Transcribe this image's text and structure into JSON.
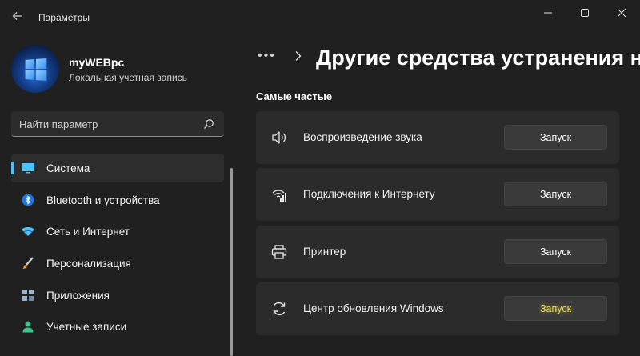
{
  "window": {
    "title": "Параметры",
    "controls": [
      "minimize-icon",
      "maximize-icon",
      "close-icon"
    ]
  },
  "profile": {
    "name": "myWEBpc",
    "account_type": "Локальная учетная запись"
  },
  "search": {
    "placeholder": "Найти параметр"
  },
  "sidebar": {
    "items": [
      {
        "label": "Система",
        "icon": "monitor-icon",
        "active": true
      },
      {
        "label": "Bluetooth и устройства",
        "icon": "bluetooth-icon",
        "active": false
      },
      {
        "label": "Сеть и Интернет",
        "icon": "wifi-icon",
        "active": false
      },
      {
        "label": "Персонализация",
        "icon": "brush-icon",
        "active": false
      },
      {
        "label": "Приложения",
        "icon": "apps-icon",
        "active": false
      },
      {
        "label": "Учетные записи",
        "icon": "person-icon",
        "active": false
      }
    ]
  },
  "header": {
    "breadcrumb_more": "•••",
    "title": "Другие средства устранения неполадок"
  },
  "section": {
    "title": "Самые частые"
  },
  "troubleshooters": [
    {
      "label": "Воспроизведение звука",
      "icon": "speaker-icon",
      "button": "Запуск"
    },
    {
      "label": "Подключения к Интернету",
      "icon": "network-icon",
      "button": "Запуск"
    },
    {
      "label": "Принтер",
      "icon": "printer-icon",
      "button": "Запуск"
    },
    {
      "label": "Центр обновления Windows",
      "icon": "update-icon",
      "button": "Запуск"
    }
  ],
  "colors": {
    "accent": "#4cc2ff",
    "background": "#202020",
    "card": "#2b2b2b",
    "highlight": "#e8dd5a"
  }
}
